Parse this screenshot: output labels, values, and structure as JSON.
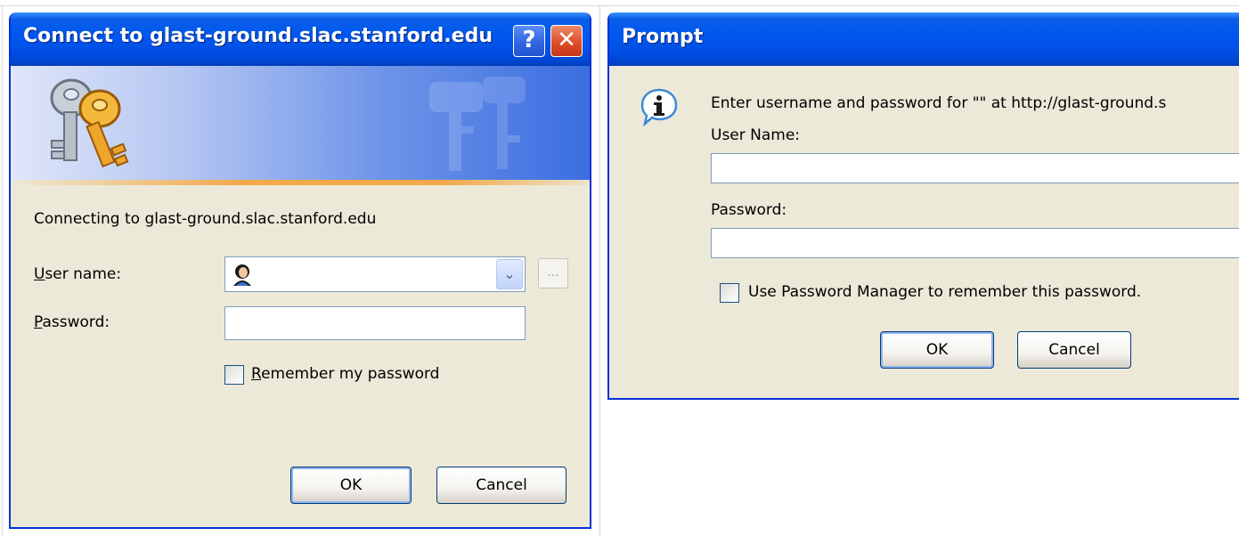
{
  "credential_dialog": {
    "title": "Connect to glast-ground.slac.stanford.edu",
    "help_button": "?",
    "close_button": "✕",
    "message": "Connecting to glast-ground.slac.stanford.edu",
    "username_label": "User name:",
    "username_value": "",
    "username_icon": "user-icon",
    "ellipsis_button": "...",
    "password_label": "Password:",
    "password_value": "",
    "remember_label": "Remember my password",
    "remember_checked": false,
    "ok_label": "OK",
    "cancel_label": "Cancel",
    "banner_icon": "keys-icon"
  },
  "prompt_dialog": {
    "title": "Prompt",
    "message": "Enter username and password for \"\" at http://glast-ground.s",
    "info_icon": "info-icon",
    "username_label": "User Name:",
    "username_value": "",
    "password_label": "Password:",
    "password_value": "",
    "remember_label": "Use Password Manager to remember this password.",
    "remember_checked": false,
    "ok_label": "OK",
    "cancel_label": "Cancel"
  },
  "colors": {
    "titlebar": "#0058ee",
    "dialog_face": "#ece9d8",
    "input_border": "#7f9db9",
    "close_button": "#de4e28"
  }
}
